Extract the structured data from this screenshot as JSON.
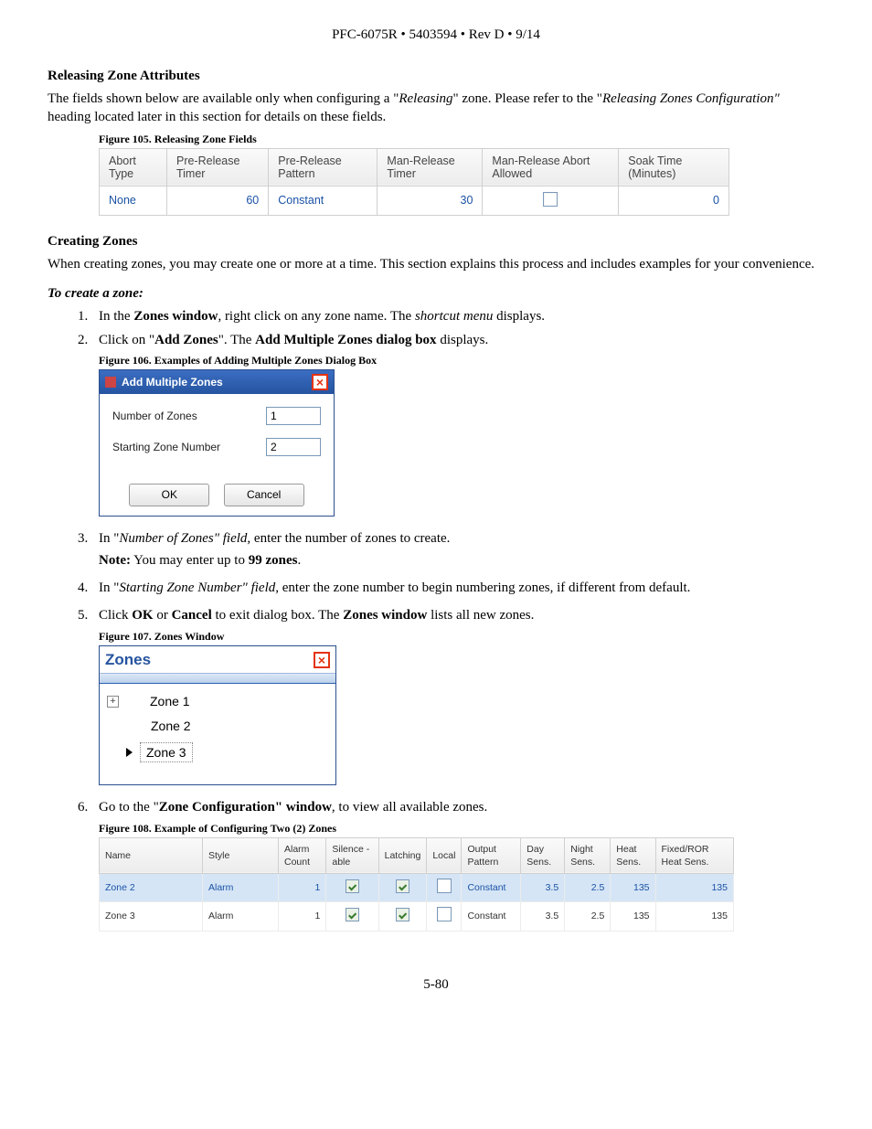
{
  "header": "PFC-6075R • 5403594 • Rev D • 9/14",
  "sec1": {
    "title": "Releasing Zone Attributes",
    "para_a": "The fields shown below are available only when configuring a \"",
    "para_b": "Releasing",
    "para_c": "\" zone. Please refer to the \"",
    "para_d": "Releasing Zones Configuration\"",
    "para_e": " heading located later in this section for details on these fields."
  },
  "fig105": {
    "caption": "Figure 105. Releasing Zone Fields",
    "headers": [
      "Abort Type",
      "Pre-Release Timer",
      "Pre-Release Pattern",
      "Man-Release Timer",
      "Man-Release Abort Allowed",
      "Soak Time (Minutes)"
    ],
    "row": {
      "abort": "None",
      "pre_timer": "60",
      "pre_pattern": "Constant",
      "man_timer": "30",
      "soak": "0"
    }
  },
  "sec2": {
    "title": "Creating Zones",
    "para": "When creating zones, you may create one or more at a time. This section explains this process and includes examples for your convenience."
  },
  "howto": {
    "title": "To create a zone:",
    "s1a": "In the ",
    "s1b": "Zones window",
    "s1c": ", right click on any zone name. The ",
    "s1d": "shortcut menu",
    "s1e": " displays.",
    "s2a": "Click on \"",
    "s2b": "Add Zones",
    "s2c": "\". The ",
    "s2d": "Add Multiple Zones dialog box",
    "s2e": " displays.",
    "s3a": "In \"",
    "s3b": "Number of Zones\" field,",
    "s3c": " enter the number of zones to create.",
    "s3note_a": "Note:",
    "s3note_b": " You may enter up to ",
    "s3note_c": "99 zones",
    "s3note_d": ".",
    "s4a": "In \"",
    "s4b": "Starting Zone Number\" field",
    "s4c": ", enter the zone number to begin numbering zones, if different from default.",
    "s5a": "Click ",
    "s5b": "OK",
    "s5c": " or ",
    "s5d": "Cancel",
    "s5e": " to exit dialog box. The ",
    "s5f": "Zones window",
    "s5g": " lists all new zones.",
    "s6a": "Go to the \"",
    "s6b": "Zone Configuration\" window",
    "s6c": ", to view all available zones."
  },
  "fig106": {
    "caption": "Figure 106. Examples of Adding Multiple Zones Dialog Box",
    "title": "Add Multiple Zones",
    "lbl1": "Number of Zones",
    "val1": "1",
    "lbl2": "Starting Zone Number",
    "val2": "2",
    "ok": "OK",
    "cancel": "Cancel"
  },
  "fig107": {
    "caption": "Figure 107. Zones Window",
    "title": "Zones",
    "items": [
      "Zone 1",
      "Zone 2",
      "Zone 3"
    ]
  },
  "fig108": {
    "caption": "Figure 108. Example of Configuring Two (2) Zones",
    "headers": [
      "Name",
      "Style",
      "Alarm Count",
      "Silence -able",
      "Latching",
      "Local",
      "Output Pattern",
      "Day Sens.",
      "Night Sens.",
      "Heat Sens.",
      "Fixed/ROR Heat Sens."
    ],
    "rows": [
      {
        "name": "Zone 2",
        "style": "Alarm",
        "alarm": "1",
        "out": "Constant",
        "day": "3.5",
        "night": "2.5",
        "heat": "135",
        "fixed": "135",
        "sel": true
      },
      {
        "name": "Zone 3",
        "style": "Alarm",
        "alarm": "1",
        "out": "Constant",
        "day": "3.5",
        "night": "2.5",
        "heat": "135",
        "fixed": "135",
        "sel": false
      }
    ]
  },
  "page": "5-80"
}
